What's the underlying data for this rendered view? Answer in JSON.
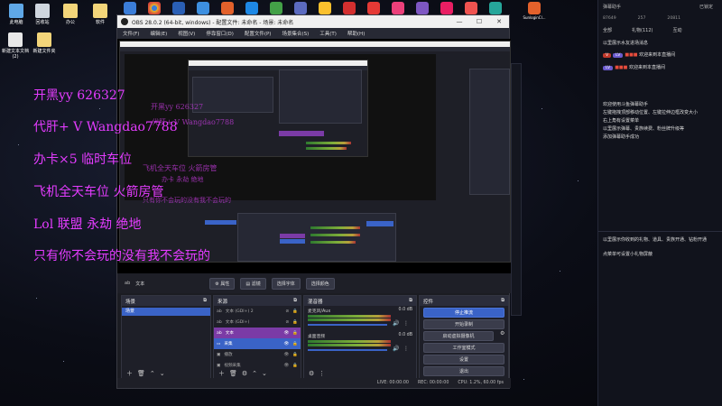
{
  "desktop": {
    "icons": [
      {
        "label": "此电脑"
      },
      {
        "label": "回收站"
      },
      {
        "label": "办公"
      },
      {
        "label": "软件"
      },
      {
        "label": "新建文本文档 (2)"
      },
      {
        "label": "新建文件夹"
      }
    ],
    "taskbar_icons": [
      {
        "label": "SunloginCl...",
        "color": "#e3612b"
      }
    ]
  },
  "overlay": {
    "lines": [
      "开黑yy   626327",
      "代肝+ V Wangdao7788",
      "办卡×5  临时车位",
      "飞机全天车位 火箭房管",
      "Lol  联盟  永劫  绝地",
      "只有你不会玩的没有我不会玩的"
    ],
    "ghost_lines": [
      "开黑yy   626327",
      "代肝+ V Wangdao7788",
      "飞机全天车位 火箭房管",
      "办卡  永劫 绝地",
      "只有你不会玩的没有我不会玩的"
    ]
  },
  "obs": {
    "title": "OBS 28.0.2 (64-bit, windows) - 配置文件: 未命名 - 场景: 未命名",
    "menu": [
      "文件(F)",
      "编辑(E)",
      "视图(V)",
      "停靠窗口(D)",
      "配置文件(P)",
      "场景集合(S)",
      "工具(T)",
      "帮助(H)"
    ],
    "source_toolbar": {
      "selected_source": "文本",
      "properties": "属性",
      "filters": "滤镜",
      "edit_text": "选择字体",
      "color": "选择颜色"
    },
    "scenes": {
      "title": "场景",
      "items": [
        "场景"
      ]
    },
    "sources": {
      "title": "来源",
      "items": [
        {
          "name": "文本 (GDI+) 2",
          "state": "none"
        },
        {
          "name": "文本 (GDI+)",
          "state": "none"
        },
        {
          "name": "文本",
          "state": "purple"
        },
        {
          "name": "采集",
          "state": "blue"
        },
        {
          "name": "播放",
          "state": "none"
        },
        {
          "name": "视频采集",
          "state": "none"
        }
      ]
    },
    "mixer": {
      "title": "混音器",
      "channels": [
        {
          "name": "麦克风/Aux",
          "db": "0.0 dB"
        },
        {
          "name": "桌面音频",
          "db": "0.0 dB"
        }
      ]
    },
    "controls": {
      "title": "控件",
      "buttons": [
        "停止推流",
        "开始录制",
        "启动虚拟摄像机",
        "工作室模式",
        "设置",
        "退出"
      ]
    },
    "status": {
      "live": "LIVE: 00:00:00",
      "rec": "REC: 00:00:00",
      "cpu": "CPU: 1.2%, 60.00 fps"
    }
  },
  "chat": {
    "header": "弹幕助手",
    "header_right": "已锁定",
    "stats": [
      "87649",
      "257",
      "20811"
    ],
    "tabs": [
      "全部",
      "礼物(112)",
      "互动"
    ],
    "lines": [
      "以里展示水友进场消息",
      "欢迎来到本直播间",
      "欢迎来到本直播间",
      "欢迎使用斗鱼弹幕助手",
      "左键拖拽顶部移动位置、左键拉伸边框改变大小",
      "右上角有设置菜单",
      "以里展示弹幕、贵族续费、粉丝牌升级等",
      "添加弹幕助手成功",
      "以里展示你收到的礼物、道具、贵族开通、钻粉开通",
      "点菜单可设置小礼物屏蔽"
    ]
  }
}
